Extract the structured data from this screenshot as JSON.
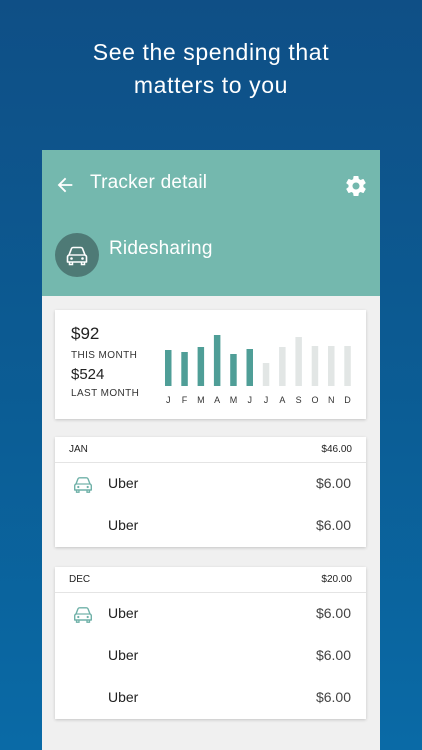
{
  "headline": {
    "line1": "See the spending that",
    "line2": "matters to you"
  },
  "appbar": {
    "title": "Tracker detail",
    "category": "Ridesharing"
  },
  "summary": {
    "this_month_value": "$92",
    "this_month_label": "THIS MONTH",
    "last_month_value": "$524",
    "last_month_label": "LAST MONTH"
  },
  "chart_data": {
    "type": "bar",
    "categories": [
      "J",
      "F",
      "M",
      "A",
      "M",
      "J",
      "J",
      "A",
      "S",
      "O",
      "N",
      "D"
    ],
    "values": [
      36,
      34,
      39,
      51,
      32,
      37,
      23,
      39,
      49,
      40,
      40,
      40
    ],
    "highlighted": [
      true,
      true,
      true,
      true,
      true,
      true,
      false,
      false,
      false,
      false,
      false,
      false
    ],
    "colors": {
      "highlight": "#4f9e97",
      "muted": "#e2e6e5"
    }
  },
  "groups": [
    {
      "month": "JAN",
      "total": "$46.00",
      "rows": [
        {
          "merchant": "Uber",
          "amount": "$6.00",
          "icon": "car-icon"
        },
        {
          "merchant": "Uber",
          "amount": "$6.00",
          "icon": ""
        }
      ]
    },
    {
      "month": "DEC",
      "total": "$20.00",
      "rows": [
        {
          "merchant": "Uber",
          "amount": "$6.00",
          "icon": "car-icon"
        },
        {
          "merchant": "Uber",
          "amount": "$6.00",
          "icon": ""
        },
        {
          "merchant": "Uber",
          "amount": "$6.00",
          "icon": ""
        }
      ]
    }
  ],
  "colors": {
    "appbar": "#74b8ae",
    "accent": "#4f9e97",
    "background": "#0f4f86"
  }
}
